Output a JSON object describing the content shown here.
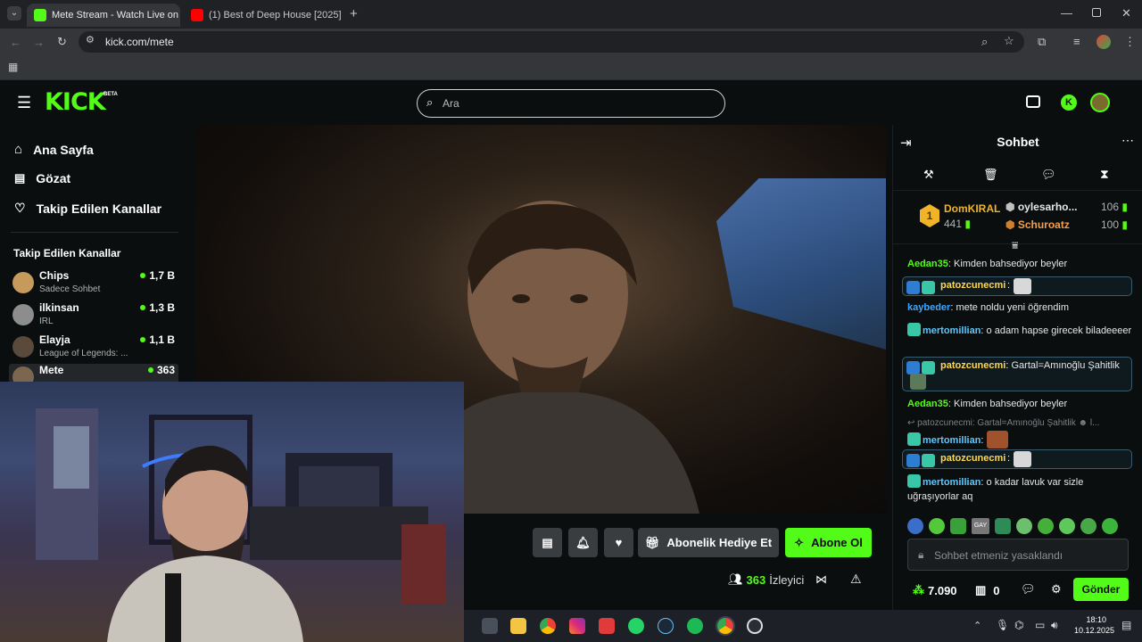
{
  "browser": {
    "tabs": [
      {
        "title": "Mete Stream - Watch Live on K",
        "active": true
      },
      {
        "title": "(1) Best of Deep House [2025] |",
        "active": false
      }
    ],
    "url": "kick.com/mete"
  },
  "kick": {
    "logo": "KICK",
    "logo_badge": "BETA",
    "search_placeholder": "Ara",
    "nav": [
      {
        "icon": "home-icon",
        "label": "Ana Sayfa"
      },
      {
        "icon": "browse-icon",
        "label": "Gözat"
      },
      {
        "icon": "heart-icon",
        "label": "Takip Edilen Kanallar"
      }
    ],
    "followed_title": "Takip Edilen Kanallar",
    "channels": [
      {
        "name": "Chips",
        "sub": "Sadece Sohbet",
        "viewers": "1,7 B"
      },
      {
        "name": "ilkinsan",
        "sub": "IRL",
        "viewers": "1,3 B"
      },
      {
        "name": "Elayja",
        "sub": "League of Legends: ...",
        "viewers": "1,1 B"
      },
      {
        "name": "Mete",
        "sub": "",
        "viewers": "363"
      }
    ]
  },
  "player": {
    "gift_label": "Abonelik Hediye Et",
    "subscribe_label": "Abone Ol",
    "viewer_count": "363",
    "viewer_label": "İzleyici"
  },
  "chat": {
    "title": "Sohbet",
    "leaderboard": {
      "top": {
        "rank": "1",
        "name": "DomKIRAL",
        "score": "441"
      },
      "second": {
        "name": "oylesarho...",
        "score": "106"
      },
      "third": {
        "name": "Schuroatz",
        "score": "100"
      }
    },
    "messages": [
      {
        "user": "Aedan35",
        "color": "#53fc18",
        "text": "Kimden bahsediyor beyler"
      },
      {
        "user": "patozcunecmi",
        "color": "#ffd84d",
        "text": ""
      },
      {
        "user": "kaybeder",
        "color": "#3ea6ff",
        "text": "mete noldu yeni öğrendim"
      },
      {
        "user": "mertomillian",
        "color": "#5cc8ff",
        "text": "o adam hapse girecek biladeeeer"
      },
      {
        "user": "patozcunecmi",
        "color": "#ffd84d",
        "text": "Gartal=Amınoğlu Şahitlik"
      },
      {
        "user": "Aedan35",
        "color": "#53fc18",
        "text": "Kimden bahsediyor beyler"
      },
      {
        "user": "mertomillian",
        "color": "#5cc8ff",
        "text": ""
      },
      {
        "user": "patozcunecmi",
        "color": "#ffd84d",
        "text": ""
      },
      {
        "user": "mertomillian",
        "color": "#5cc8ff",
        "text": "o kadar lavuk var sizle uğraşıyorlar aq"
      }
    ],
    "reply_preview": "patozcunecmi: Gartal=Amınoğlu Şahitlik",
    "reply_suffix": "l...",
    "emote_gay": "GAY",
    "input_placeholder": "Sohbet etmeniz yasaklandı",
    "points": "7.090",
    "gift_count": "0",
    "send_label": "Gönder"
  },
  "taskbar": {
    "time": "18:10",
    "date": "10.12.2025"
  },
  "colors": {
    "kick_green": "#53fc18",
    "bg": "#0b0e0f",
    "button_gray": "#3a3d40"
  }
}
